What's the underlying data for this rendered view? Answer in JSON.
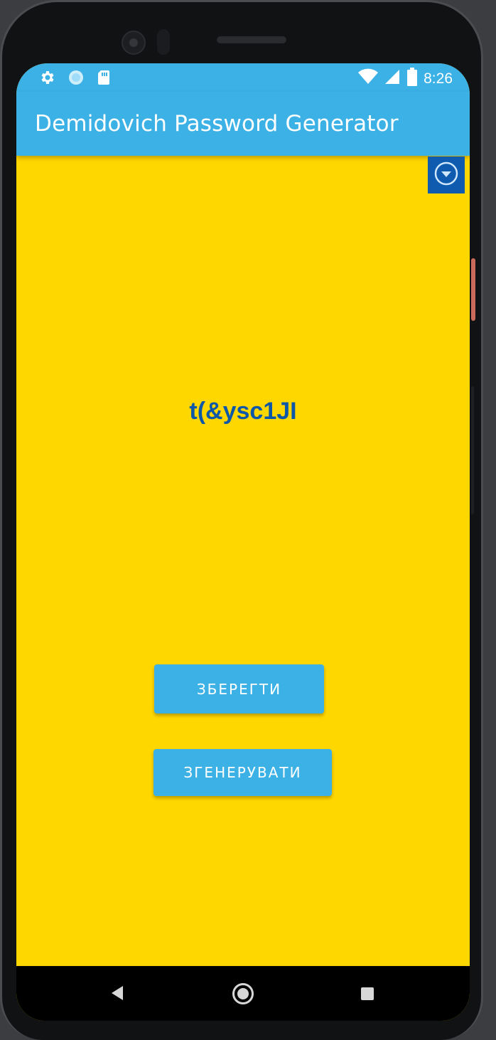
{
  "status_bar": {
    "time": "8:26",
    "left_icons": [
      "gear-icon",
      "sync-icon",
      "sd-card-icon"
    ],
    "right_icons": [
      "wifi-icon",
      "cell-signal-icon",
      "battery-icon"
    ]
  },
  "app_bar": {
    "title": "Demidovich Password Generator"
  },
  "main": {
    "password": "t(&ysc1JI",
    "menu_icon": "arrow-drop-down-circle-icon",
    "save_label": "ЗБЕРЕГТИ",
    "generate_label": "ЗГЕНЕРУВАТИ"
  },
  "nav_bar": {
    "icons": [
      "back-icon",
      "home-icon",
      "recent-apps-icon"
    ]
  },
  "colors": {
    "background": "#ffd700",
    "app_bar": "#3cb1e6",
    "accent": "#0f5bb0",
    "password_text": "#0d57a8",
    "button": "#3cb1e6"
  }
}
